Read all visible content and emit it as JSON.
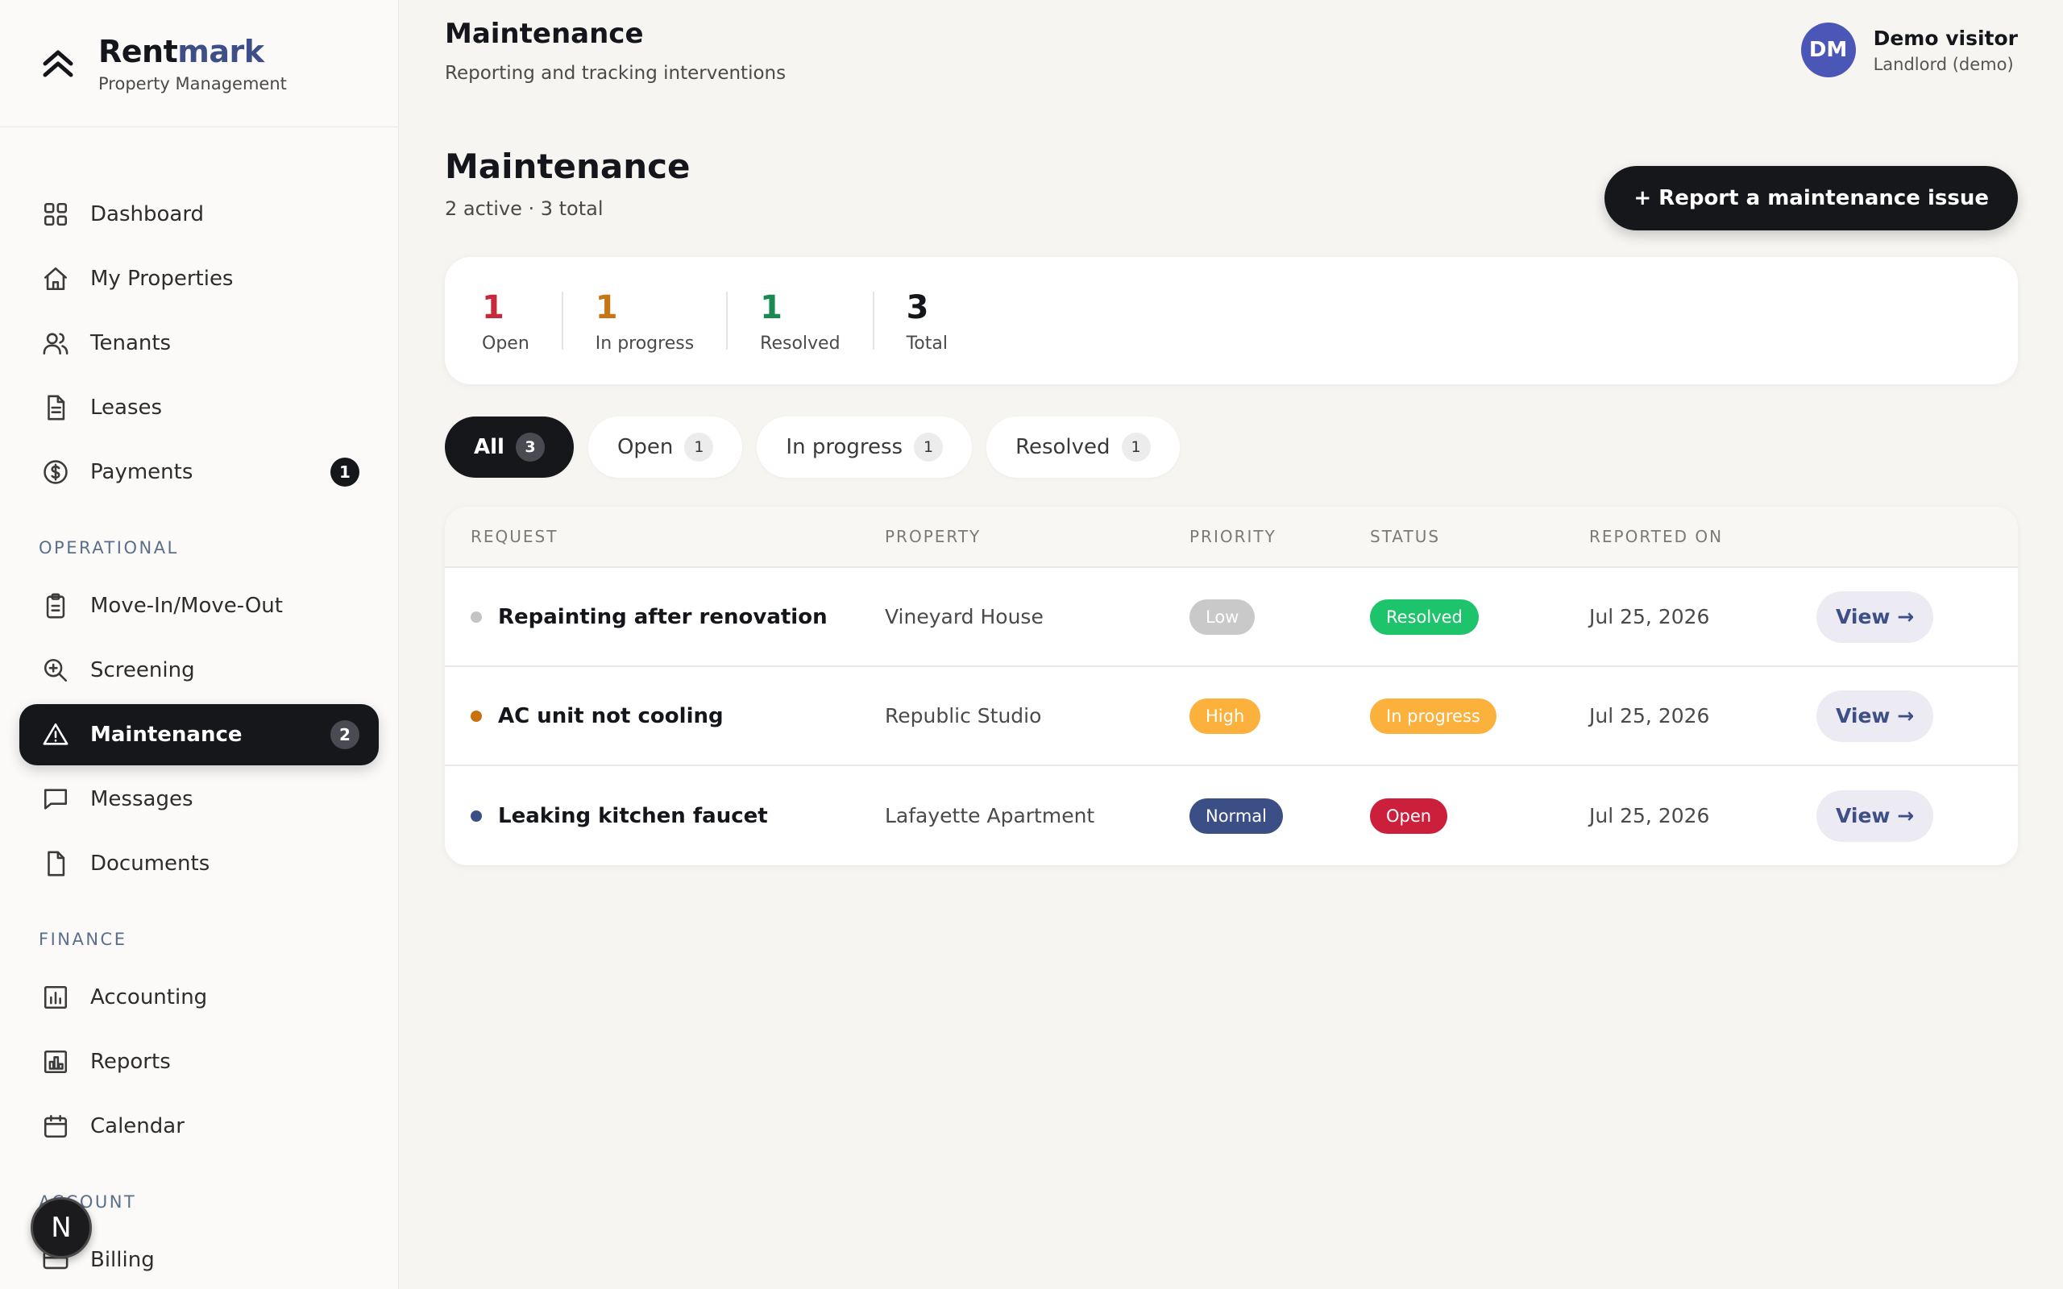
{
  "brand": {
    "name_main": "Rent",
    "name_accent": "mark",
    "subtitle": "Property Management"
  },
  "nav": {
    "main": [
      {
        "label": "Dashboard",
        "icon": "grid-icon"
      },
      {
        "label": "My Properties",
        "icon": "home-icon"
      },
      {
        "label": "Tenants",
        "icon": "users-icon"
      },
      {
        "label": "Leases",
        "icon": "file-icon"
      },
      {
        "label": "Payments",
        "icon": "dollar-circle-icon",
        "badge": "1"
      }
    ],
    "operational_title": "OPERATIONAL",
    "operational": [
      {
        "label": "Move-In/Move-Out",
        "icon": "clipboard-icon"
      },
      {
        "label": "Screening",
        "icon": "zoom-icon"
      },
      {
        "label": "Maintenance",
        "icon": "warning-icon",
        "badge": "2",
        "active": true
      },
      {
        "label": "Messages",
        "icon": "message-icon"
      },
      {
        "label": "Documents",
        "icon": "document-icon"
      }
    ],
    "finance_title": "FINANCE",
    "finance": [
      {
        "label": "Accounting",
        "icon": "bar-chart-icon"
      },
      {
        "label": "Reports",
        "icon": "report-icon"
      },
      {
        "label": "Calendar",
        "icon": "calendar-icon"
      }
    ],
    "account_title": "ACCOUNT",
    "account": [
      {
        "label": "Billing",
        "icon": "credit-card-icon"
      }
    ]
  },
  "floating_button_label": "N",
  "header": {
    "title": "Maintenance",
    "subtitle": "Reporting and tracking interventions"
  },
  "user": {
    "initials": "DM",
    "name": "Demo visitor",
    "role": "Landlord (demo)"
  },
  "page": {
    "title": "Maintenance",
    "subtitle": "2 active · 3 total",
    "report_button": "+ Report a maintenance issue"
  },
  "stats": [
    {
      "value": "1",
      "label": "Open",
      "color": "#c8283c"
    },
    {
      "value": "1",
      "label": "In progress",
      "color": "#c87514"
    },
    {
      "value": "1",
      "label": "Resolved",
      "color": "#1a8a52"
    },
    {
      "value": "3",
      "label": "Total",
      "color": "#14161c"
    }
  ],
  "filters": [
    {
      "label": "All",
      "count": "3",
      "active": true
    },
    {
      "label": "Open",
      "count": "1"
    },
    {
      "label": "In progress",
      "count": "1"
    },
    {
      "label": "Resolved",
      "count": "1"
    }
  ],
  "table": {
    "headers": [
      "REQUEST",
      "PROPERTY",
      "PRIORITY",
      "STATUS",
      "REPORTED ON"
    ],
    "rows": [
      {
        "request": "Repainting after renovation",
        "dot_color": "#c4c4c4",
        "property": "Vineyard House",
        "priority": "Low",
        "priority_color": "#c9c9c9",
        "status": "Resolved",
        "status_color": "#1ec46b",
        "date": "Jul 25, 2026",
        "action": "View →"
      },
      {
        "request": "AC unit not cooling",
        "dot_color": "#c8700f",
        "property": "Republic Studio",
        "priority": "High",
        "priority_color": "#fbb13c",
        "status": "In progress",
        "status_color": "#fbb13c",
        "date": "Jul 25, 2026",
        "action": "View →"
      },
      {
        "request": "Leaking kitchen faucet",
        "dot_color": "#3b4f86",
        "property": "Lafayette Apartment",
        "priority": "Normal",
        "priority_color": "#3b4f86",
        "status": "Open",
        "status_color": "#cc1f3c",
        "date": "Jul 25, 2026",
        "action": "View →"
      }
    ]
  }
}
